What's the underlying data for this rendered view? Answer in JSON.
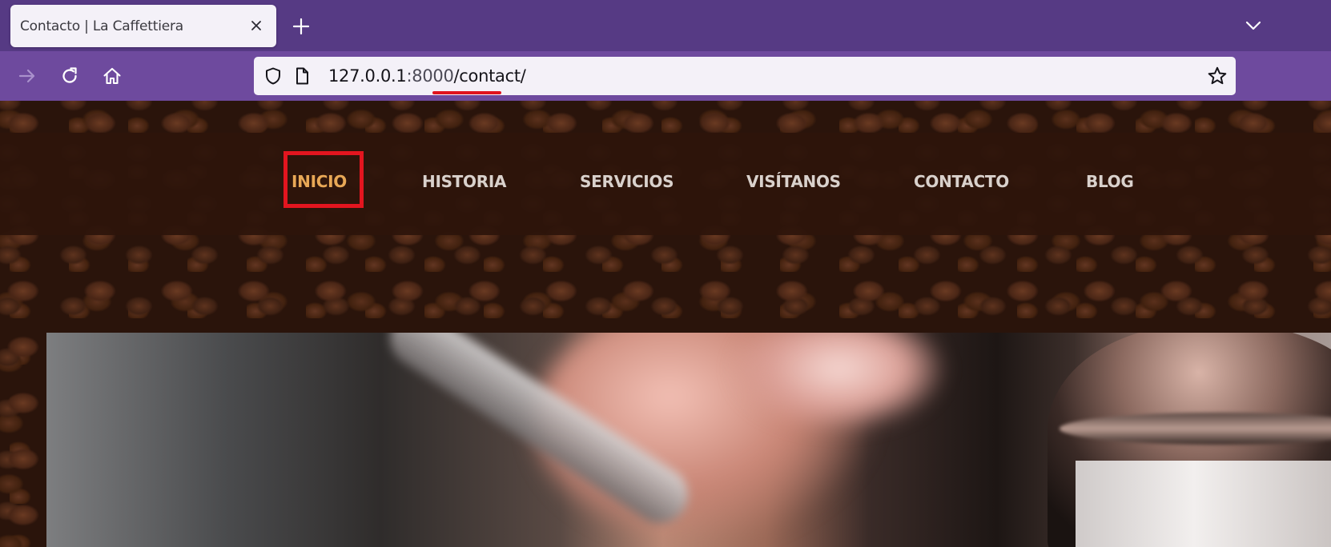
{
  "browser": {
    "tab": {
      "title": "Contacto | La Caffettiera"
    },
    "url": {
      "host": "127.0.0.1",
      "port": ":8000",
      "path": "/contact/"
    }
  },
  "site": {
    "menu": [
      {
        "label": "INICIO",
        "active": true
      },
      {
        "label": "HISTORIA",
        "active": false
      },
      {
        "label": "SERVICIOS",
        "active": false
      },
      {
        "label": "VISÍTANOS",
        "active": false
      },
      {
        "label": "CONTACTO",
        "active": false
      },
      {
        "label": "BLOG",
        "active": false
      }
    ]
  },
  "colors": {
    "tabbar": "#563a84",
    "toolbar": "#6e4a9e",
    "menu_active": "#e8a856",
    "menu_text": "#d9d1cc",
    "highlight_box": "#e3151f"
  },
  "icons": [
    "close-icon",
    "plus-icon",
    "chevron-down-icon",
    "forward-arrow-icon",
    "reload-icon",
    "home-icon",
    "shield-icon",
    "page-icon",
    "star-icon"
  ]
}
